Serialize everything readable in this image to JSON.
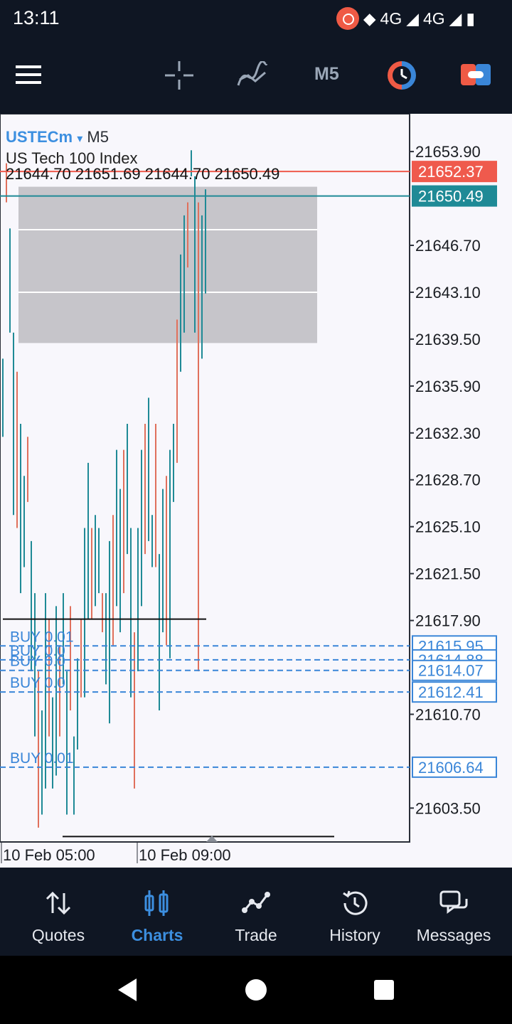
{
  "status_bar": {
    "time": "13:11",
    "network1": "4G",
    "network2": "4G"
  },
  "toolbar": {
    "timeframe": "M5",
    "icons": [
      "menu-icon",
      "crosshair-icon",
      "indicators-icon",
      "timeframe",
      "clock-icon",
      "account-toggle-icon"
    ]
  },
  "chart": {
    "symbol": "USTECm",
    "symbol_arrow": "▾",
    "timeframe": "M5",
    "description": "US Tech 100 Index",
    "ohlc": "21644.70 21651.69 21644.70 21650.49",
    "price_axis": [
      "21653.90",
      "21646.70",
      "21643.10",
      "21639.50",
      "21635.90",
      "21632.30",
      "21628.70",
      "21625.10",
      "21621.50",
      "21617.90",
      "21610.70",
      "21603.50"
    ],
    "ask_price": "21652.37",
    "bid_price": "21650.49",
    "buy_order_prices": [
      "21615.95",
      "21614.88",
      "21614.07",
      "21612.41",
      "21606.64"
    ],
    "buy_labels": [
      "BUY 0.01",
      "BUY 0.0",
      "BUY 0.0",
      "BUY 0.0",
      "BUY 0.01"
    ],
    "time_labels": [
      "10 Feb 05:00",
      "10 Feb 09:00"
    ],
    "colors": {
      "up": "#1f8a96",
      "down": "#e0705c",
      "order": "#3a86d8",
      "ask_bg": "#ef5a4d",
      "bid_bg": "#1f8a96",
      "zone": "#c6c5ca"
    }
  },
  "chart_data": {
    "type": "candlestick",
    "unit": "price",
    "ylim": [
      21600.9,
      21656.8
    ],
    "series_note_ranges": [
      [
        21632,
        21638
      ],
      [
        21650,
        21653
      ],
      [
        21640,
        21648
      ],
      [
        21626,
        21640
      ],
      [
        21625,
        21637
      ],
      [
        21620,
        21633
      ],
      [
        21622,
        21629
      ],
      [
        21627,
        21632
      ],
      [
        21614,
        21624
      ],
      [
        21609,
        21620
      ],
      [
        21602,
        21614
      ],
      [
        21603,
        21611
      ],
      [
        21605,
        21620
      ],
      [
        21609,
        21618
      ],
      [
        21605,
        21612
      ],
      [
        21606,
        21619
      ],
      [
        21609,
        21616
      ],
      [
        21613,
        21620
      ],
      [
        21603,
        21614
      ],
      [
        21611,
        21619
      ],
      [
        21603,
        21609
      ],
      [
        21608,
        21615
      ],
      [
        21612,
        21618
      ],
      [
        21612,
        21625
      ],
      [
        21618,
        21630
      ],
      [
        21618,
        21625
      ],
      [
        21619,
        21626
      ],
      [
        21620,
        21625
      ],
      [
        21617,
        21620
      ],
      [
        21613,
        21620
      ],
      [
        21610,
        21624
      ],
      [
        21616,
        21626
      ],
      [
        21619,
        21631
      ],
      [
        21617,
        21628
      ],
      [
        21620,
        21631
      ],
      [
        21623,
        21633
      ],
      [
        21612,
        21625
      ],
      [
        21605,
        21617
      ],
      [
        21614,
        21625
      ],
      [
        21619,
        21631
      ],
      [
        21623,
        21633
      ],
      [
        21624,
        21635
      ],
      [
        21622,
        21626
      ],
      [
        21622,
        21633
      ],
      [
        21611,
        21623
      ],
      [
        21617,
        21628
      ],
      [
        21616,
        21629
      ],
      [
        21615,
        21631
      ],
      [
        21627,
        21633
      ],
      [
        21630,
        21641
      ],
      [
        21637,
        21646
      ],
      [
        21640,
        21649
      ],
      [
        21645,
        21650
      ],
      [
        21652,
        21654
      ],
      [
        21640,
        21652
      ],
      [
        21614,
        21650
      ],
      [
        21638,
        21649
      ],
      [
        21643,
        21651
      ]
    ]
  },
  "nav": {
    "quotes": "Quotes",
    "charts": "Charts",
    "trade": "Trade",
    "history": "History",
    "messages": "Messages"
  }
}
